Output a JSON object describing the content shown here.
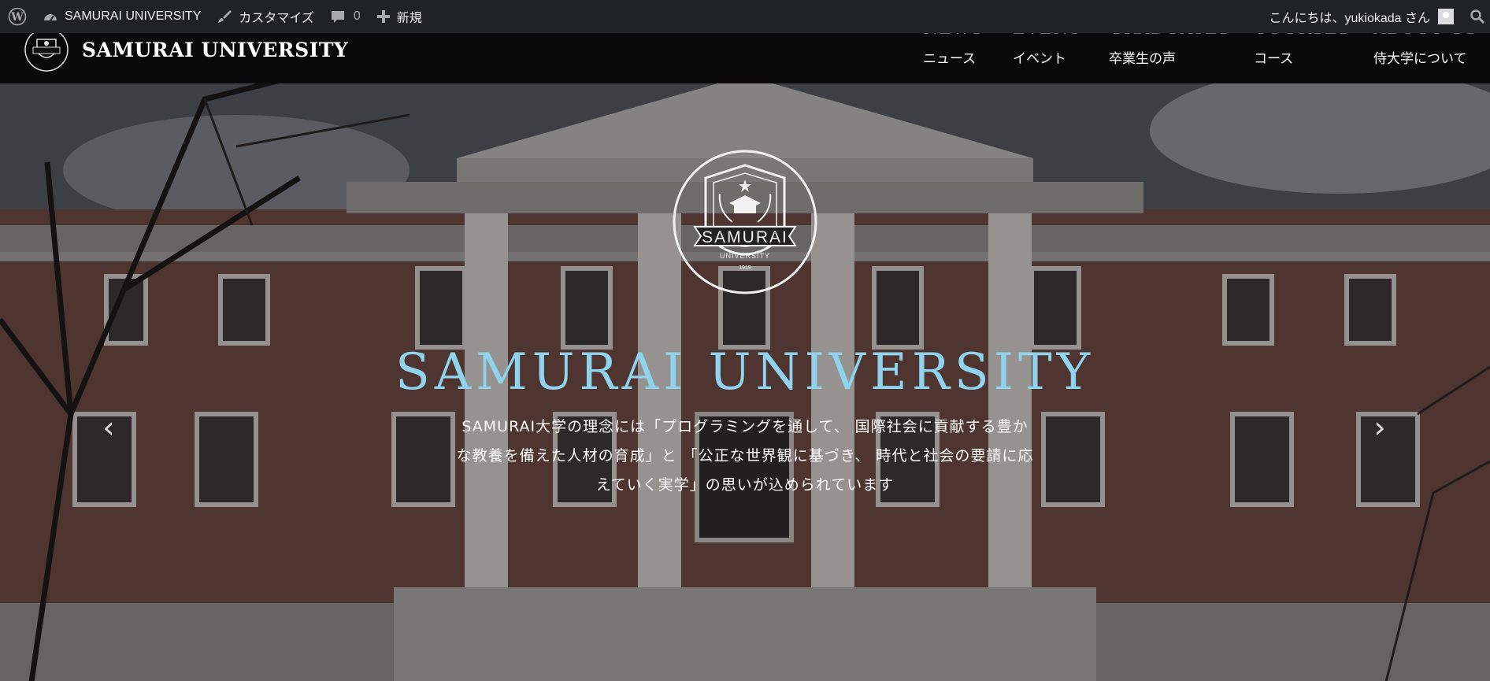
{
  "admin_bar": {
    "wp_logo": "wordpress-icon",
    "site_name": "SAMURAI UNIVERSITY",
    "customize_label": "カスタマイズ",
    "comments_count": "0",
    "new_label": "新規",
    "greeting": "こんにちは、yukiokada さん"
  },
  "header": {
    "site_title": "SAMURAI UNIVERSITY",
    "nav": [
      {
        "en": "NEWS",
        "ja": "ニュース"
      },
      {
        "en": "EVENT",
        "ja": "イベント"
      },
      {
        "en": "GRADUATES",
        "ja": "卒業生の声"
      },
      {
        "en": "COURSES",
        "ja": "コース"
      },
      {
        "en": "ABOUT US",
        "ja": "侍大学について"
      }
    ]
  },
  "hero": {
    "emblem": {
      "name": "SAMURAI",
      "sub": "UNIVERSITY",
      "year": "1919"
    },
    "title": "SAMURAI UNIVERSITY",
    "lines": [
      "SAMURAI大学の理念には「プログラミングを通して、 国際社会に貢献する豊か",
      "な教養を備えた人材の育成」と 「公正な世界観に基づき、 時代と社会の要請に応",
      "えていく実学」の思いが込められています"
    ],
    "prev_arrow": "‹",
    "next_arrow": "›"
  },
  "colors": {
    "admin_bar_bg": "#1d2327",
    "header_bg": "#080808",
    "hero_title": "#8fd3ef"
  }
}
